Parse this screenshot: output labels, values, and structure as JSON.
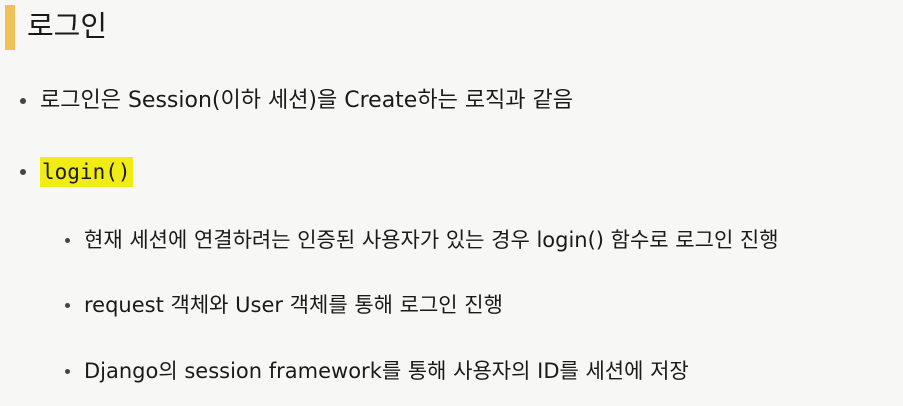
{
  "slide": {
    "title": "로그인",
    "accent_color": "#f1c15a",
    "highlight_color": "#f1ec14",
    "bullets": [
      "로그인은 Session(이하 세션)을 Create하는 로직과 같음",
      "login()"
    ],
    "sub_bullets": [
      "현재 세션에 연결하려는 인증된 사용자가 있는 경우 login() 함수로 로그인 진행",
      "request 객체와 User 객체를 통해 로그인 진행",
      "Django의 session framework를 통해 사용자의 ID를 세션에 저장"
    ]
  }
}
